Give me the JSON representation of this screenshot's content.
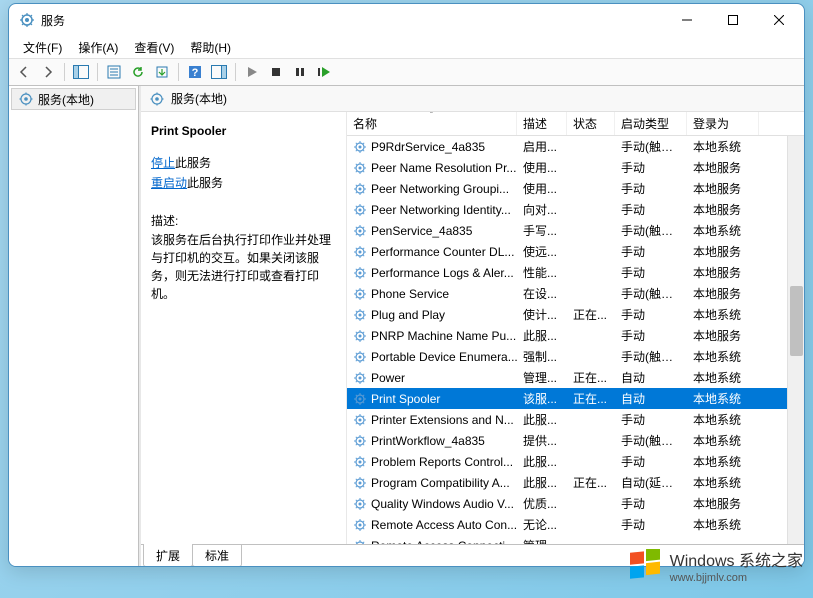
{
  "window": {
    "title": "服务",
    "minimize": "—",
    "maximize": "☐",
    "close": "✕"
  },
  "menu": {
    "file": "文件(F)",
    "action": "操作(A)",
    "view": "查看(V)",
    "help": "帮助(H)"
  },
  "tree": {
    "root": "服务(本地)"
  },
  "content_header": "服务(本地)",
  "detail": {
    "service_name": "Print Spooler",
    "stop_link": "停止",
    "stop_suffix": "此服务",
    "restart_link": "重启动",
    "restart_suffix": "此服务",
    "desc_label": "描述:",
    "desc_text": "该服务在后台执行打印作业并处理与打印机的交互。如果关闭该服务，则无法进行打印或查看打印机。"
  },
  "columns": {
    "name": "名称",
    "desc": "描述",
    "status": "状态",
    "startup": "启动类型",
    "logon": "登录为"
  },
  "rows": [
    {
      "name": "P9RdrService_4a835",
      "desc": "启用...",
      "status": "",
      "startup": "手动(触发...",
      "logon": "本地系统",
      "selected": false
    },
    {
      "name": "Peer Name Resolution Pr...",
      "desc": "使用...",
      "status": "",
      "startup": "手动",
      "logon": "本地服务",
      "selected": false
    },
    {
      "name": "Peer Networking Groupi...",
      "desc": "使用...",
      "status": "",
      "startup": "手动",
      "logon": "本地服务",
      "selected": false
    },
    {
      "name": "Peer Networking Identity...",
      "desc": "向对...",
      "status": "",
      "startup": "手动",
      "logon": "本地服务",
      "selected": false
    },
    {
      "name": "PenService_4a835",
      "desc": "手写...",
      "status": "",
      "startup": "手动(触发...",
      "logon": "本地系统",
      "selected": false
    },
    {
      "name": "Performance Counter DL...",
      "desc": "使远...",
      "status": "",
      "startup": "手动",
      "logon": "本地服务",
      "selected": false
    },
    {
      "name": "Performance Logs & Aler...",
      "desc": "性能...",
      "status": "",
      "startup": "手动",
      "logon": "本地服务",
      "selected": false
    },
    {
      "name": "Phone Service",
      "desc": "在设...",
      "status": "",
      "startup": "手动(触发...",
      "logon": "本地服务",
      "selected": false
    },
    {
      "name": "Plug and Play",
      "desc": "使计...",
      "status": "正在...",
      "startup": "手动",
      "logon": "本地系统",
      "selected": false
    },
    {
      "name": "PNRP Machine Name Pu...",
      "desc": "此服...",
      "status": "",
      "startup": "手动",
      "logon": "本地服务",
      "selected": false
    },
    {
      "name": "Portable Device Enumera...",
      "desc": "强制...",
      "status": "",
      "startup": "手动(触发...",
      "logon": "本地系统",
      "selected": false
    },
    {
      "name": "Power",
      "desc": "管理...",
      "status": "正在...",
      "startup": "自动",
      "logon": "本地系统",
      "selected": false
    },
    {
      "name": "Print Spooler",
      "desc": "该服...",
      "status": "正在...",
      "startup": "自动",
      "logon": "本地系统",
      "selected": true
    },
    {
      "name": "Printer Extensions and N...",
      "desc": "此服...",
      "status": "",
      "startup": "手动",
      "logon": "本地系统",
      "selected": false
    },
    {
      "name": "PrintWorkflow_4a835",
      "desc": "提供...",
      "status": "",
      "startup": "手动(触发...",
      "logon": "本地系统",
      "selected": false
    },
    {
      "name": "Problem Reports Control...",
      "desc": "此服...",
      "status": "",
      "startup": "手动",
      "logon": "本地系统",
      "selected": false
    },
    {
      "name": "Program Compatibility A...",
      "desc": "此服...",
      "status": "正在...",
      "startup": "自动(延迟...",
      "logon": "本地系统",
      "selected": false
    },
    {
      "name": "Quality Windows Audio V...",
      "desc": "优质...",
      "status": "",
      "startup": "手动",
      "logon": "本地服务",
      "selected": false
    },
    {
      "name": "Remote Access Auto Con...",
      "desc": "无论...",
      "status": "",
      "startup": "手动",
      "logon": "本地系统",
      "selected": false
    },
    {
      "name": "Remote Access Connecti...",
      "desc": "管理...",
      "status": "",
      "startup": "",
      "logon": "",
      "selected": false
    }
  ],
  "tabs": {
    "extended": "扩展",
    "standard": "标准"
  },
  "watermark": {
    "brand": "Windows",
    "sub": "系统之家",
    "url": "www.bjjmlv.com"
  }
}
